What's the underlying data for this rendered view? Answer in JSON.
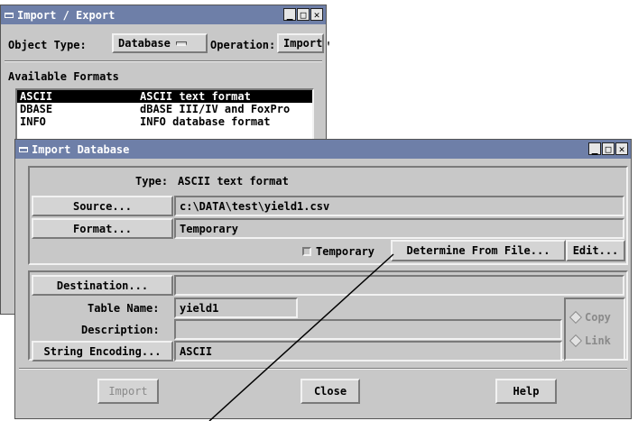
{
  "import_export": {
    "title": "Import / Export",
    "object_type_label": "Object Type:",
    "object_type_value": "Database",
    "operation_label": "Operation:",
    "operation_value": "Import",
    "available_formats_label": "Available Formats",
    "formats": [
      {
        "name": "ASCII",
        "desc": "ASCII text format",
        "selected": true
      },
      {
        "name": "DBASE",
        "desc": "dBASE III/IV and FoxPro",
        "selected": false
      },
      {
        "name": "INFO",
        "desc": "INFO database format",
        "selected": false
      }
    ]
  },
  "import_database": {
    "title": "Import Database",
    "type_label": "Type:",
    "type_value": "ASCII text format",
    "source_button": "Source...",
    "source_value": "c:\\DATA\\test\\yield1.csv",
    "format_button": "Format...",
    "format_value": "Temporary",
    "temporary_checkbox": "Temporary",
    "determine_button": "Determine From File...",
    "edit_button": "Edit...",
    "destination_button": "Destination...",
    "destination_value": "",
    "table_name_label": "Table Name:",
    "table_name_value": "yield1",
    "description_label": "Description:",
    "description_value": "",
    "string_encoding_button": "String Encoding...",
    "string_encoding_value": "ASCII",
    "copy_option": "Copy",
    "link_option": "Link",
    "import_button": "Import",
    "close_button": "Close",
    "help_button": "Help"
  },
  "icons": {
    "window_menu": "window-menu-icon",
    "minimize": "minimize-icon",
    "maximize": "maximize-icon",
    "close": "close-icon"
  },
  "colors": {
    "titlebar": "#6e7fa8",
    "window_bg": "#c8c8c8",
    "selection": "#000000"
  }
}
